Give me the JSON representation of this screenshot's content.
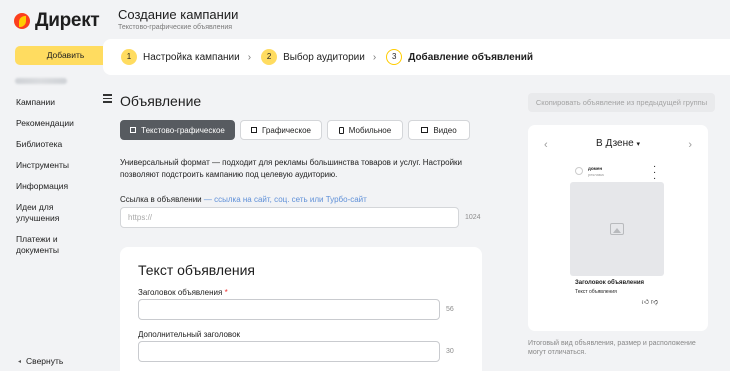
{
  "app": {
    "logo_text": "Директ"
  },
  "header": {
    "title": "Создание кампании",
    "subtitle": "Текстово-графические объявления"
  },
  "sidebar": {
    "add_button": "Добавить",
    "items": [
      {
        "label": "Кампании"
      },
      {
        "label": "Рекомендации"
      },
      {
        "label": "Библиотека"
      },
      {
        "label": "Инструменты"
      },
      {
        "label": "Информация"
      },
      {
        "label": "Идеи для улучшения"
      },
      {
        "label": "Платежи и документы"
      }
    ],
    "collapse_label": "Свернуть"
  },
  "stepper": {
    "steps": [
      {
        "num": "1",
        "label": "Настройка кампании"
      },
      {
        "num": "2",
        "label": "Выбор аудитории"
      },
      {
        "num": "3",
        "label": "Добавление объявлений"
      }
    ],
    "active_step": 3
  },
  "section": {
    "title": "Объявление",
    "copy_button": "Скопировать объявление из предыдущей группы"
  },
  "format_tabs": [
    {
      "label": "Текстово-графическое",
      "icon": "text-graphic-icon",
      "active": true
    },
    {
      "label": "Графическое",
      "icon": "image-icon",
      "active": false
    },
    {
      "label": "Мобильное",
      "icon": "mobile-icon",
      "active": false
    },
    {
      "label": "Видео",
      "icon": "video-icon",
      "active": false
    }
  ],
  "description": "Универсальный формат — подходит для рекламы большинства товаров и услуг. Настройки позволяют подстроить кампанию под целевую аудиторию.",
  "link_field": {
    "label": "Ссылка в объявлении",
    "hint": "— ссылка на сайт, соц. сеть или Турбо-сайт",
    "placeholder": "https://",
    "counter": "1024"
  },
  "ad_text": {
    "title": "Текст объявления",
    "headline_label": "Заголовок объявления",
    "headline_required": "*",
    "headline_counter": "56",
    "extra_label": "Дополнительный заголовок",
    "extra_counter": "30"
  },
  "preview": {
    "placement": "В Дзене",
    "domain": "домен",
    "sub": "реклама",
    "headline": "Заголовок объявления",
    "text": "Текст объявления",
    "note": "Итоговый вид объявления, размер и расположение могут отличаться."
  },
  "colors": {
    "accent": "#ffdc60",
    "active_tab": "#575b60",
    "link": "#5f90d8",
    "background": "#f2f3f5"
  }
}
